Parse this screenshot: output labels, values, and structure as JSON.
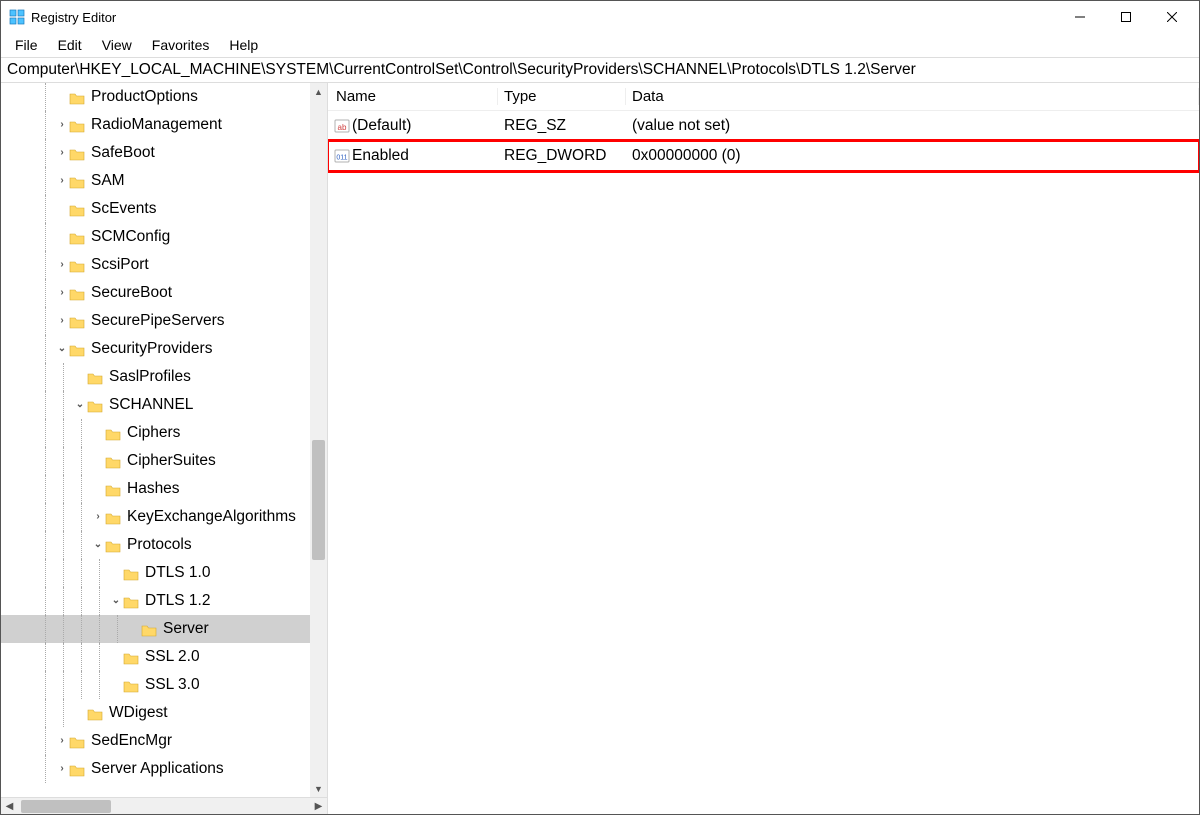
{
  "window": {
    "title": "Registry Editor"
  },
  "menu": [
    "File",
    "Edit",
    "View",
    "Favorites",
    "Help"
  ],
  "address": "Computer\\HKEY_LOCAL_MACHINE\\SYSTEM\\CurrentControlSet\\Control\\SecurityProviders\\SCHANNEL\\Protocols\\DTLS 1.2\\Server",
  "tree": [
    {
      "label": "ProductOptions",
      "indent": 3,
      "expander": "none"
    },
    {
      "label": "RadioManagement",
      "indent": 3,
      "expander": "collapsed"
    },
    {
      "label": "SafeBoot",
      "indent": 3,
      "expander": "collapsed"
    },
    {
      "label": "SAM",
      "indent": 3,
      "expander": "collapsed"
    },
    {
      "label": "ScEvents",
      "indent": 3,
      "expander": "none"
    },
    {
      "label": "SCMConfig",
      "indent": 3,
      "expander": "none"
    },
    {
      "label": "ScsiPort",
      "indent": 3,
      "expander": "collapsed"
    },
    {
      "label": "SecureBoot",
      "indent": 3,
      "expander": "collapsed"
    },
    {
      "label": "SecurePipeServers",
      "indent": 3,
      "expander": "collapsed"
    },
    {
      "label": "SecurityProviders",
      "indent": 3,
      "expander": "expanded"
    },
    {
      "label": "SaslProfiles",
      "indent": 4,
      "expander": "none"
    },
    {
      "label": "SCHANNEL",
      "indent": 4,
      "expander": "expanded"
    },
    {
      "label": "Ciphers",
      "indent": 5,
      "expander": "none"
    },
    {
      "label": "CipherSuites",
      "indent": 5,
      "expander": "none"
    },
    {
      "label": "Hashes",
      "indent": 5,
      "expander": "none"
    },
    {
      "label": "KeyExchangeAlgorithms",
      "indent": 5,
      "expander": "collapsed"
    },
    {
      "label": "Protocols",
      "indent": 5,
      "expander": "expanded"
    },
    {
      "label": "DTLS 1.0",
      "indent": 6,
      "expander": "none"
    },
    {
      "label": "DTLS 1.2",
      "indent": 6,
      "expander": "expanded"
    },
    {
      "label": "Server",
      "indent": 7,
      "expander": "none",
      "selected": true
    },
    {
      "label": "SSL 2.0",
      "indent": 6,
      "expander": "none"
    },
    {
      "label": "SSL 3.0",
      "indent": 6,
      "expander": "none"
    },
    {
      "label": "WDigest",
      "indent": 4,
      "expander": "none"
    },
    {
      "label": "SedEncMgr",
      "indent": 3,
      "expander": "collapsed"
    },
    {
      "label": "Server Applications",
      "indent": 3,
      "expander": "collapsed"
    }
  ],
  "list": {
    "headers": {
      "name": "Name",
      "type": "Type",
      "data": "Data"
    },
    "rows": [
      {
        "icon": "sz",
        "name": "(Default)",
        "type": "REG_SZ",
        "data": "(value not set)",
        "highlight": false
      },
      {
        "icon": "dword",
        "name": "Enabled",
        "type": "REG_DWORD",
        "data": "0x00000000 (0)",
        "highlight": true
      }
    ]
  }
}
